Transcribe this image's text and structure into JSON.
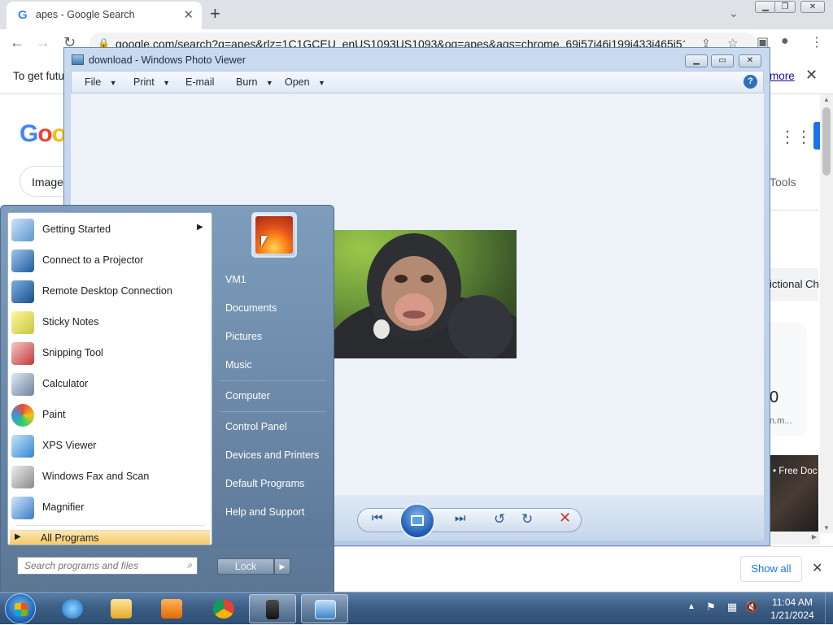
{
  "chrome": {
    "tab_title": "apes - Google Search",
    "tab_icon": "G",
    "url": "google.com/search?q=apes&rlz=1C1GCEU_enUS1093US1093&oq=apes&aqs=chrome..69i57j46i199i433i465i51...",
    "infobar_text": "To get futu",
    "infobar_link": "more",
    "logo_text": "Goo",
    "images_chip": "Image",
    "tools_label": "Tools",
    "fictional_text": "ictional Ch",
    "card_number": "0",
    "card_small": "n.m...",
    "gorilla_caption": "• Free Doc",
    "show_all": "Show all"
  },
  "photo_viewer": {
    "title": "download - Windows Photo Viewer",
    "menu": {
      "file": "File",
      "print": "Print",
      "email": "E-mail",
      "burn": "Burn",
      "open": "Open"
    }
  },
  "start_menu": {
    "programs": [
      {
        "label": "Getting Started",
        "has_submenu": true
      },
      {
        "label": "Connect to a Projector"
      },
      {
        "label": "Remote Desktop Connection"
      },
      {
        "label": "Sticky Notes"
      },
      {
        "label": "Snipping Tool"
      },
      {
        "label": "Calculator"
      },
      {
        "label": "Paint"
      },
      {
        "label": "XPS Viewer"
      },
      {
        "label": "Windows Fax and Scan"
      },
      {
        "label": "Magnifier"
      }
    ],
    "all_programs": "All Programs",
    "search_placeholder": "Search programs and files",
    "right_links": {
      "user": "VM1",
      "documents": "Documents",
      "pictures": "Pictures",
      "music": "Music",
      "computer": "Computer",
      "control_panel": "Control Panel",
      "devices_printers": "Devices and Printers",
      "default_programs": "Default Programs",
      "help_support": "Help and Support"
    },
    "lock_label": "Lock"
  },
  "taskbar": {
    "time": "11:04 AM",
    "date": "1/21/2024"
  }
}
